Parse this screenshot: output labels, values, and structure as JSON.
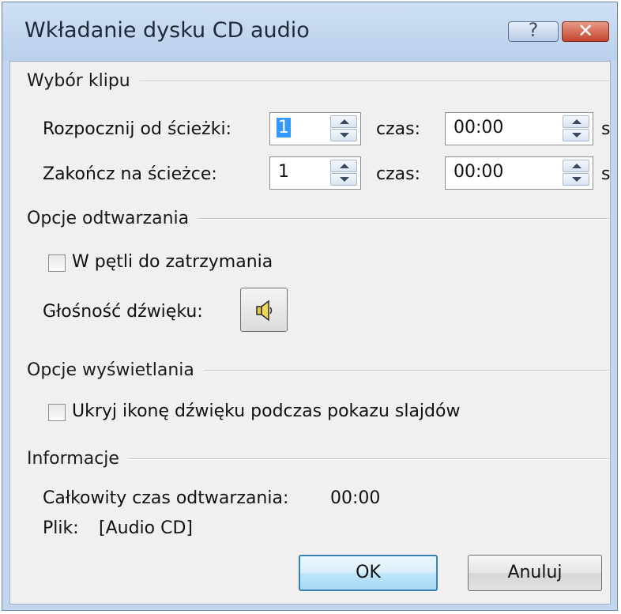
{
  "window": {
    "title": "Wkładanie dysku CD audio",
    "help_glyph": "?",
    "close_glyph": "✕"
  },
  "clip_selection": {
    "heading": "Wybór klipu",
    "start_track_label": "Rozpocznij od ścieżki:",
    "start_track_value": "1",
    "start_time_label": "czas:",
    "start_time_value": "00:00",
    "start_unit": "s",
    "end_track_label": "Zakończ na ścieżce:",
    "end_track_value": "1",
    "end_time_label": "czas:",
    "end_time_value": "00:00",
    "end_unit": "s"
  },
  "playback_options": {
    "heading": "Opcje odtwarzania",
    "loop_label": "W pętli do zatrzymania",
    "loop_checked": false,
    "volume_label": "Głośność dźwięku:",
    "volume_icon": "speaker-icon"
  },
  "display_options": {
    "heading": "Opcje wyświetlania",
    "hide_icon_label": "Ukryj ikonę dźwięku podczas pokazu slajdów",
    "hide_icon_checked": false
  },
  "information": {
    "heading": "Informacje",
    "total_time_label": "Całkowity czas odtwarzania:",
    "total_time_value": "00:00",
    "file_label": "Plik:",
    "file_value": "[Audio CD]"
  },
  "buttons": {
    "ok": "OK",
    "cancel": "Anuluj"
  }
}
